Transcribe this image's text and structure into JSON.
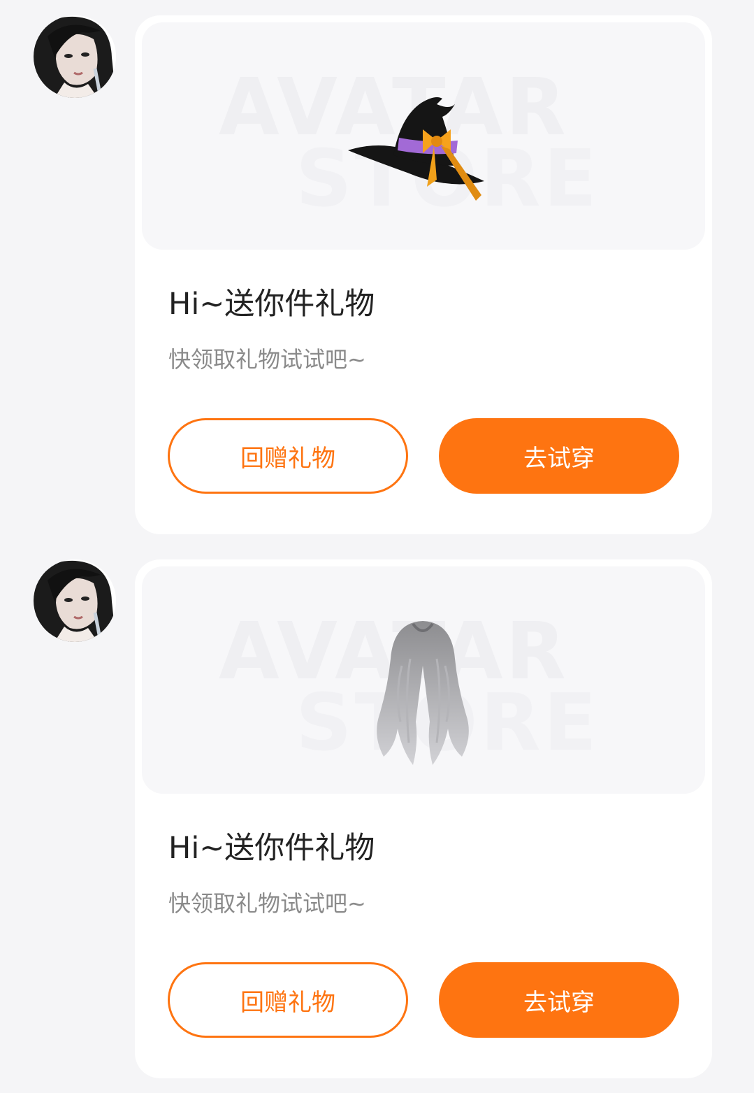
{
  "accent_color": "#fe7411",
  "messages": [
    {
      "avatar_icon": "user-avatar-icon",
      "preview": {
        "watermark_line1": "AVATAR",
        "watermark_line2": "STORE",
        "item_icon": "witch-hat-icon"
      },
      "title": "Hi~送你件礼物",
      "subtitle": "快领取礼物试试吧~",
      "return_gift_label": "回赠礼物",
      "try_on_label": "去试穿"
    },
    {
      "avatar_icon": "user-avatar-icon",
      "preview": {
        "watermark_line1": "AVATAR",
        "watermark_line2": "STORE",
        "item_icon": "wavy-hair-icon"
      },
      "title": "Hi~送你件礼物",
      "subtitle": "快领取礼物试试吧~",
      "return_gift_label": "回赠礼物",
      "try_on_label": "去试穿"
    }
  ]
}
